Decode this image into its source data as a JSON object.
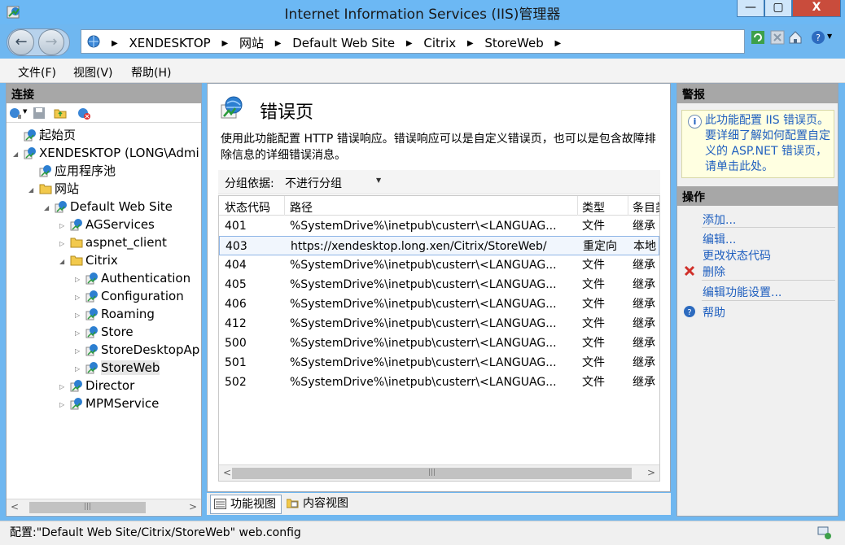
{
  "window": {
    "title": "Internet Information Services (IIS)管理器",
    "min_label": "—",
    "max_label": "▢",
    "close_label": "X"
  },
  "nav": {
    "back_label": "←",
    "forward_label": "→",
    "breadcrumbs": [
      "XENDESKTOP",
      "网站",
      "Default Web Site",
      "Citrix",
      "StoreWeb"
    ],
    "separator": "▶"
  },
  "menu": {
    "file": "文件(F)",
    "view": "视图(V)",
    "help": "帮助(H)"
  },
  "connections": {
    "header": "连接",
    "tree": [
      {
        "label": "起始页",
        "indent": 0,
        "toggle": ""
      },
      {
        "label": "XENDESKTOP (LONG\\Admi",
        "indent": 0,
        "toggle": "◢"
      },
      {
        "label": "应用程序池",
        "indent": 1,
        "toggle": ""
      },
      {
        "label": "网站",
        "indent": 1,
        "toggle": "◢"
      },
      {
        "label": "Default Web Site",
        "indent": 2,
        "toggle": "◢"
      },
      {
        "label": "AGServices",
        "indent": 3,
        "toggle": "▷"
      },
      {
        "label": "aspnet_client",
        "indent": 3,
        "toggle": "▷"
      },
      {
        "label": "Citrix",
        "indent": 3,
        "toggle": "◢"
      },
      {
        "label": "Authentication",
        "indent": 4,
        "toggle": "▷"
      },
      {
        "label": "Configuration",
        "indent": 4,
        "toggle": "▷"
      },
      {
        "label": "Roaming",
        "indent": 4,
        "toggle": "▷"
      },
      {
        "label": "Store",
        "indent": 4,
        "toggle": "▷"
      },
      {
        "label": "StoreDesktopAp",
        "indent": 4,
        "toggle": "▷"
      },
      {
        "label": "StoreWeb",
        "indent": 4,
        "toggle": "▷",
        "selected": true
      },
      {
        "label": "Director",
        "indent": 3,
        "toggle": "▷"
      },
      {
        "label": "MPMService",
        "indent": 3,
        "toggle": "▷"
      }
    ],
    "scroll_left": "<",
    "scroll_right": ">",
    "scroll_thumb": "|||"
  },
  "main": {
    "title": "错误页",
    "description": "使用此功能配置 HTTP 错误响应。错误响应可以是自定义错误页，也可以是包含故障排除信息的详细错误消息。",
    "group_by_label": "分组依据:",
    "group_by_value": "不进行分组",
    "columns": [
      "状态代码",
      "路径",
      "类型",
      "条目类"
    ],
    "rows": [
      {
        "code": "401",
        "path": "%SystemDrive%\\inetpub\\custerr\\<LANGUAG...",
        "type": "文件",
        "entry": "继承"
      },
      {
        "code": "403",
        "path": "https://xendesktop.long.xen/Citrix/StoreWeb/",
        "type": "重定向",
        "entry": "本地",
        "selected": true
      },
      {
        "code": "404",
        "path": "%SystemDrive%\\inetpub\\custerr\\<LANGUAG...",
        "type": "文件",
        "entry": "继承"
      },
      {
        "code": "405",
        "path": "%SystemDrive%\\inetpub\\custerr\\<LANGUAG...",
        "type": "文件",
        "entry": "继承"
      },
      {
        "code": "406",
        "path": "%SystemDrive%\\inetpub\\custerr\\<LANGUAG...",
        "type": "文件",
        "entry": "继承"
      },
      {
        "code": "412",
        "path": "%SystemDrive%\\inetpub\\custerr\\<LANGUAG...",
        "type": "文件",
        "entry": "继承"
      },
      {
        "code": "500",
        "path": "%SystemDrive%\\inetpub\\custerr\\<LANGUAG...",
        "type": "文件",
        "entry": "继承"
      },
      {
        "code": "501",
        "path": "%SystemDrive%\\inetpub\\custerr\\<LANGUAG...",
        "type": "文件",
        "entry": "继承"
      },
      {
        "code": "502",
        "path": "%SystemDrive%\\inetpub\\custerr\\<LANGUAG...",
        "type": "文件",
        "entry": "继承"
      }
    ],
    "scroll_left": "<",
    "scroll_right": ">",
    "scroll_thumb": "|||"
  },
  "views": {
    "feature_view": "功能视图",
    "content_view": "内容视图"
  },
  "alerts": {
    "header": "警报",
    "icon": "i",
    "message": "此功能配置 IIS 错误页。要详细了解如何配置自定义的 ASP.NET 错误页，请单击此处。"
  },
  "actions": {
    "header": "操作",
    "add": "添加...",
    "edit": "编辑...",
    "change_status_code": "更改状态代码",
    "delete": "删除",
    "edit_feature_settings": "编辑功能设置...",
    "help": "帮助"
  },
  "status": {
    "text": "配置:\"Default Web Site/Citrix/StoreWeb\" web.config"
  },
  "colors": {
    "titlebar": "#6cb8f4",
    "link": "#1f5fbf",
    "close": "#c94c3c",
    "selected_row": "#f1f6fd"
  }
}
